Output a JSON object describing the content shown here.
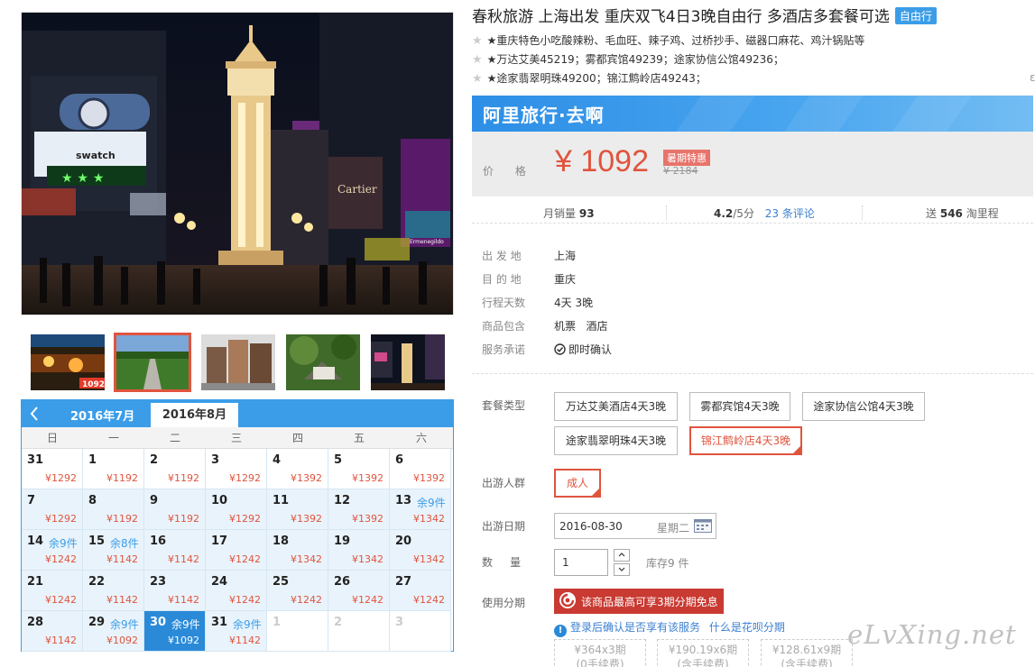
{
  "title": {
    "text": "春秋旅游 上海出发 重庆双飞4日3晚自由行 多酒店多套餐可选",
    "tag": "自由行"
  },
  "features": [
    "★重庆特色小吃酸辣粉、毛血旺、辣子鸡、过桥抄手、磁器口麻花、鸡汁锅贴等",
    "★万达艾美45219；雾都宾馆49239；途家协信公馆49236；",
    "★途家翡翠明珠49200；锦江鹪岭店49243；"
  ],
  "edge_mark": "ε",
  "brand": {
    "name": "阿里旅行·去啊"
  },
  "price": {
    "label": "价 格",
    "current": "¥ 1092",
    "promo": "暑期特惠",
    "original": "¥ 2184"
  },
  "stats": {
    "sales_label": "月销量",
    "sales_value": "93",
    "rating_value": "4.2",
    "rating_suffix": "/5分",
    "reviews_link": "23 条评论",
    "points_prefix": "送",
    "points_value": "546",
    "points_suffix": "淘里程"
  },
  "info": [
    {
      "label": "出 发 地",
      "value": "上海"
    },
    {
      "label": "目 的 地",
      "value": "重庆"
    },
    {
      "label": "行程天数",
      "value": "4天 3晚"
    },
    {
      "label": "商品包含",
      "value": "机票   酒店"
    },
    {
      "label": "服务承诺",
      "value": "即时确认"
    }
  ],
  "form": {
    "package_label": "套餐类型",
    "packages": [
      "万达艾美酒店4天3晚",
      "雾都宾馆4天3晚",
      "途家协信公馆4天3晚",
      "途家翡翠明珠4天3晚",
      "锦江鹪岭店4天3晚"
    ],
    "selected_package": "锦江鹪岭店4天3晚",
    "traveler_label": "出游人群",
    "traveler_option": "成人",
    "date_label": "出游日期",
    "date_value": "2016-08-30",
    "weekday": "星期二",
    "qty_label": "数     量",
    "qty_value": "1",
    "stock": "库存9 件",
    "installment_label": "使用分期",
    "installment_button": "该商品最高可享3期分期免息",
    "login_note": "登录后确认是否享有该服务",
    "huabei_link": "什么是花呗分期",
    "plans": [
      {
        "amount": "¥364x3期",
        "fee": "(0手续费)"
      },
      {
        "amount": "¥190.19x6期",
        "fee": "(含手续费)"
      },
      {
        "amount": "¥128.61x9期",
        "fee": "(含手续费)"
      }
    ]
  },
  "calendar": {
    "month_prev": "2016年7月",
    "month_current": "2016年8月",
    "weekdays": [
      "日",
      "一",
      "二",
      "三",
      "四",
      "五",
      "六"
    ],
    "days": [
      {
        "d": "31",
        "price": "¥1292",
        "rem": ""
      },
      {
        "d": "1",
        "price": "¥1192",
        "rem": ""
      },
      {
        "d": "2",
        "price": "¥1192",
        "rem": ""
      },
      {
        "d": "3",
        "price": "¥1292",
        "rem": ""
      },
      {
        "d": "4",
        "price": "¥1392",
        "rem": ""
      },
      {
        "d": "5",
        "price": "¥1392",
        "rem": ""
      },
      {
        "d": "6",
        "price": "¥1392",
        "rem": ""
      },
      {
        "d": "7",
        "price": "¥1292",
        "rem": ""
      },
      {
        "d": "8",
        "price": "¥1192",
        "rem": ""
      },
      {
        "d": "9",
        "price": "¥1192",
        "rem": ""
      },
      {
        "d": "10",
        "price": "¥1292",
        "rem": ""
      },
      {
        "d": "11",
        "price": "¥1392",
        "rem": ""
      },
      {
        "d": "12",
        "price": "¥1392",
        "rem": ""
      },
      {
        "d": "13",
        "price": "¥1342",
        "rem": "余9件"
      },
      {
        "d": "14",
        "price": "¥1242",
        "rem": "余9件"
      },
      {
        "d": "15",
        "price": "¥1142",
        "rem": "余8件"
      },
      {
        "d": "16",
        "price": "¥1142",
        "rem": ""
      },
      {
        "d": "17",
        "price": "¥1242",
        "rem": ""
      },
      {
        "d": "18",
        "price": "¥1342",
        "rem": ""
      },
      {
        "d": "19",
        "price": "¥1342",
        "rem": ""
      },
      {
        "d": "20",
        "price": "¥1342",
        "rem": ""
      },
      {
        "d": "21",
        "price": "¥1242",
        "rem": ""
      },
      {
        "d": "22",
        "price": "¥1142",
        "rem": ""
      },
      {
        "d": "23",
        "price": "¥1142",
        "rem": ""
      },
      {
        "d": "24",
        "price": "¥1242",
        "rem": ""
      },
      {
        "d": "25",
        "price": "¥1242",
        "rem": ""
      },
      {
        "d": "26",
        "price": "¥1242",
        "rem": ""
      },
      {
        "d": "27",
        "price": "¥1242",
        "rem": ""
      },
      {
        "d": "28",
        "price": "¥1142",
        "rem": ""
      },
      {
        "d": "29",
        "price": "¥1092",
        "rem": "余9件"
      },
      {
        "d": "30",
        "price": "¥1092",
        "rem": "余9件"
      },
      {
        "d": "31",
        "price": "¥1142",
        "rem": "余9件"
      },
      {
        "d": "1",
        "price": "",
        "rem": ""
      },
      {
        "d": "2",
        "price": "",
        "rem": ""
      },
      {
        "d": "3",
        "price": "",
        "rem": ""
      }
    ],
    "selected_day": "30"
  },
  "gallery": {
    "main_photo_signs": [
      "swatch",
      "Cartier",
      "Ermenegildo"
    ],
    "thumbs": [
      {
        "label": "1092",
        "active": false
      },
      {
        "label": "",
        "active": true
      },
      {
        "label": "",
        "active": false
      },
      {
        "label": "",
        "active": false
      },
      {
        "label": "",
        "active": false
      }
    ]
  },
  "watermark": "eLvXing.net",
  "colors": {
    "accent": "#3b9de8",
    "price_red": "#e0543e",
    "install_red": "#c93a32"
  }
}
